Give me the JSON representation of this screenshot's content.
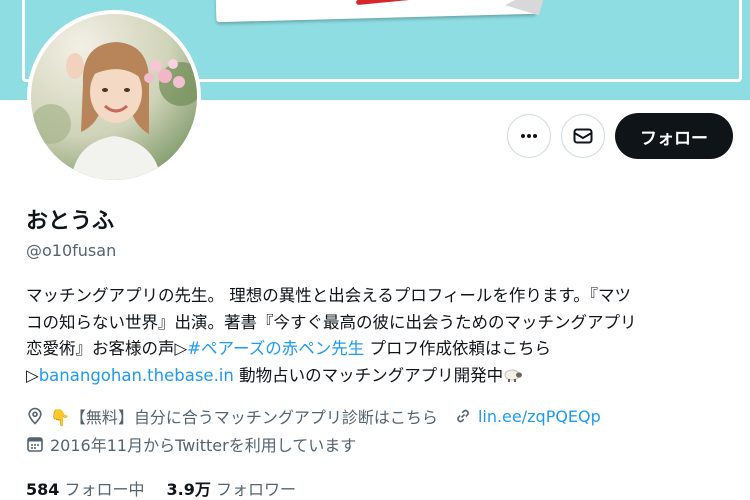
{
  "profile": {
    "name": "おとうふ",
    "handle": "@o10fusan",
    "follow_label": "フォロー"
  },
  "bio": {
    "l1": "マッチングアプリの先生。 理想の異性と出会えるプロフィールを作ります。『マツ",
    "l2": "コの知らない世界』出演。著書『今すぐ最高の彼に出会うためのマッチングアプリ",
    "l3a": "恋愛術』お客様の声▷",
    "l3_tag": "#ペアーズの赤ペン先生",
    "l3b": " プロフ作成依頼はこちら",
    "l4a": "▷",
    "l4_link": "banangohan.thebase.in",
    "l4b": " 動物占いのマッチングアプリ開発中"
  },
  "meta": {
    "location": "👇【無料】自分に合うマッチングアプリ診断はこちら",
    "url": "lin.ee/zqPQEQp",
    "joined": "2016年11月からTwitterを利用しています"
  },
  "stats": {
    "following_count": "584",
    "following_label": "フォロー中",
    "followers_count": "3.9万",
    "followers_label": "フォロワー"
  },
  "icons": {
    "more": "more-icon",
    "message": "mail-icon",
    "location": "location-pin-icon",
    "link": "link-icon",
    "calendar": "calendar-icon",
    "emoji": "sheep-emoji"
  },
  "colors": {
    "banner": "#8ddde2",
    "link": "#1d9bf0",
    "follow_bg": "#0f1419",
    "secondary": "#536471"
  }
}
